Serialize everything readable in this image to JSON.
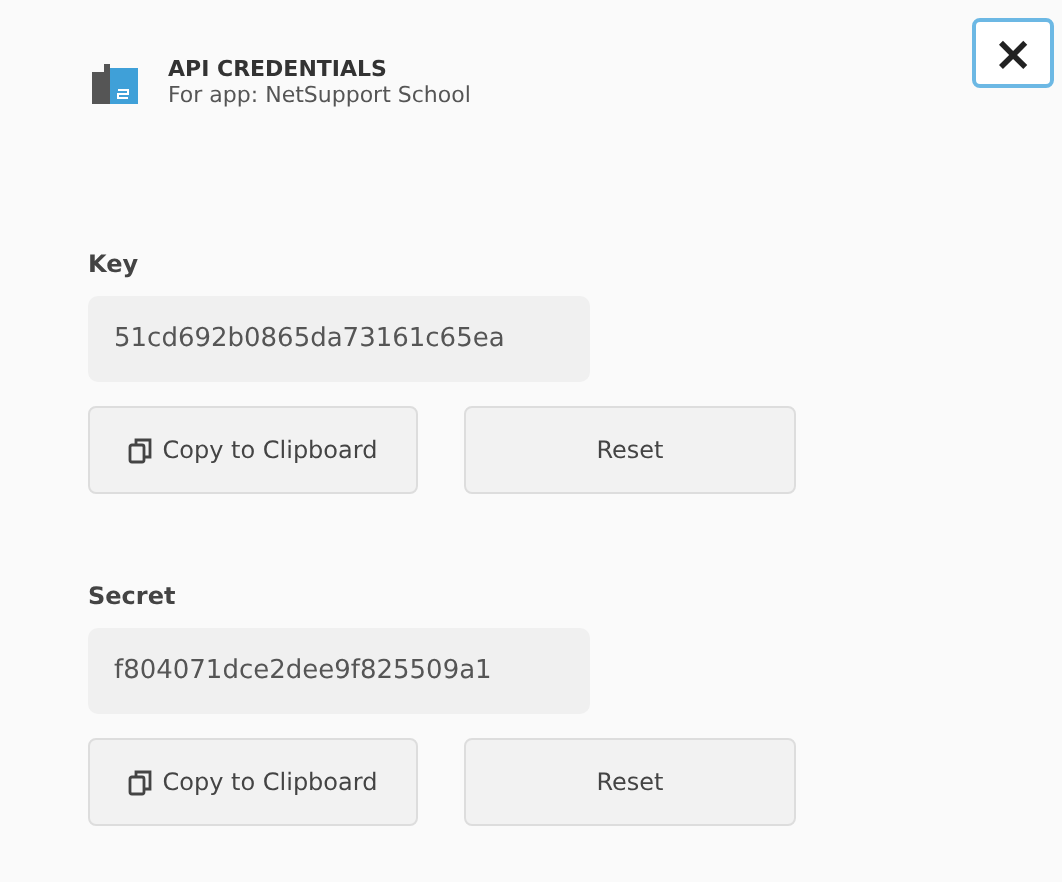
{
  "header": {
    "title": "API CREDENTIALS",
    "subtitle": "For app: NetSupport School",
    "close": "×"
  },
  "credentials": [
    {
      "label": "Key",
      "value": "51cd692b0865da73161c65ea",
      "copy": "Copy to Clipboard",
      "reset": "Reset"
    },
    {
      "label": "Secret",
      "value": "f804071dce2dee9f825509a1",
      "copy": "Copy to Clipboard",
      "reset": "Reset"
    }
  ]
}
